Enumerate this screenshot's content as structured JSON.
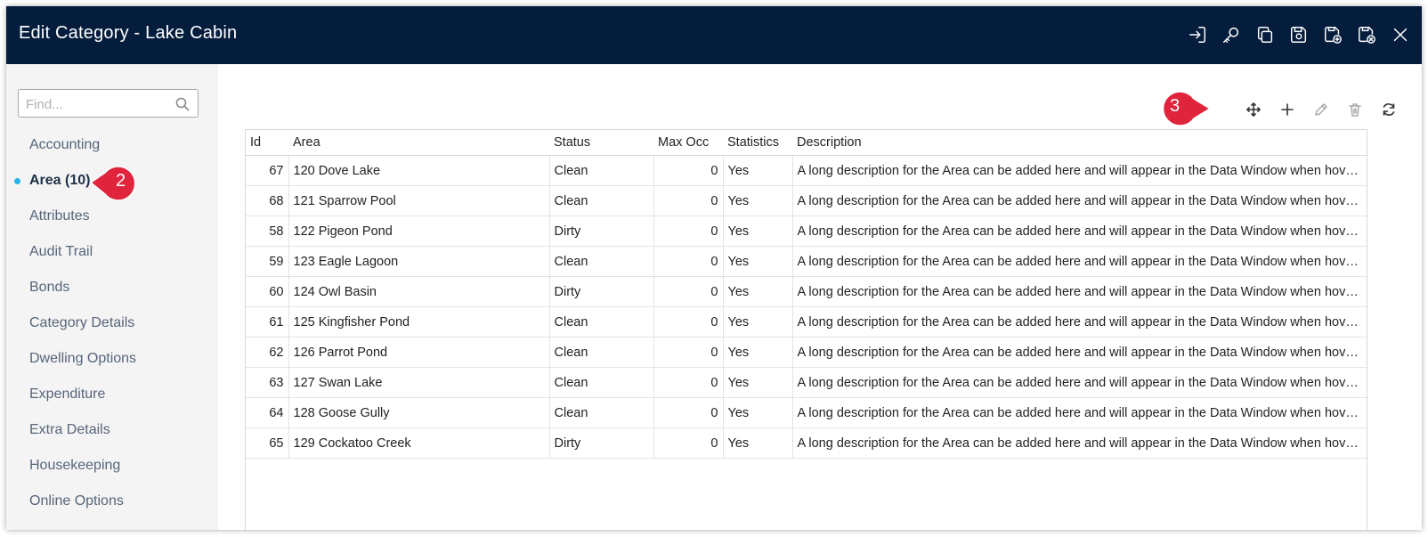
{
  "window": {
    "title": "Edit Category - Lake Cabin"
  },
  "titlebar_icons": [
    "sign-in-icon",
    "key-icon",
    "copy-icon",
    "save-icon",
    "save-and-new-icon",
    "cancel-icon",
    "close-icon"
  ],
  "sidebar": {
    "search_placeholder": "Find...",
    "items": [
      {
        "label": "Accounting"
      },
      {
        "label": "Area (10)",
        "active": true
      },
      {
        "label": "Attributes"
      },
      {
        "label": "Audit Trail"
      },
      {
        "label": "Bonds"
      },
      {
        "label": "Category Details"
      },
      {
        "label": "Dwelling Options"
      },
      {
        "label": "Expenditure"
      },
      {
        "label": "Extra Details"
      },
      {
        "label": "Housekeeping"
      },
      {
        "label": "Online Options"
      }
    ]
  },
  "callouts": {
    "step2": "2",
    "step3": "3"
  },
  "toolbar_icons": [
    "move-icon",
    "add-icon",
    "edit-icon",
    "delete-icon",
    "refresh-icon"
  ],
  "table": {
    "columns": [
      "Id",
      "Area",
      "Status",
      "Max Occ",
      "Statistics",
      "Description"
    ],
    "rows": [
      {
        "id": "67",
        "area": "120 Dove Lake",
        "status": "Clean",
        "max_occ": "0",
        "statistics": "Yes",
        "description": "A long description for the Area can be added here and will appear in the Data Window when hovering"
      },
      {
        "id": "68",
        "area": "121 Sparrow Pool",
        "status": "Clean",
        "max_occ": "0",
        "statistics": "Yes",
        "description": "A long description for the Area can be added here and will appear in the Data Window when hovering"
      },
      {
        "id": "58",
        "area": "122 Pigeon Pond",
        "status": "Dirty",
        "max_occ": "0",
        "statistics": "Yes",
        "description": "A long description for the Area can be added here and will appear in the Data Window when hovering"
      },
      {
        "id": "59",
        "area": "123 Eagle Lagoon",
        "status": "Clean",
        "max_occ": "0",
        "statistics": "Yes",
        "description": "A long description for the Area can be added here and will appear in the Data Window when hovering"
      },
      {
        "id": "60",
        "area": "124 Owl Basin",
        "status": "Dirty",
        "max_occ": "0",
        "statistics": "Yes",
        "description": "A long description for the Area can be added here and will appear in the Data Window when hovering"
      },
      {
        "id": "61",
        "area": "125 Kingfisher Pond",
        "status": "Clean",
        "max_occ": "0",
        "statistics": "Yes",
        "description": "A long description for the Area can be added here and will appear in the Data Window when hovering"
      },
      {
        "id": "62",
        "area": "126 Parrot Pond",
        "status": "Clean",
        "max_occ": "0",
        "statistics": "Yes",
        "description": "A long description for the Area can be added here and will appear in the Data Window when hovering"
      },
      {
        "id": "63",
        "area": "127 Swan Lake",
        "status": "Clean",
        "max_occ": "0",
        "statistics": "Yes",
        "description": "A long description for the Area can be added here and will appear in the Data Window when hovering"
      },
      {
        "id": "64",
        "area": "128 Goose Gully",
        "status": "Clean",
        "max_occ": "0",
        "statistics": "Yes",
        "description": "A long description for the Area can be added here and will appear in the Data Window when hovering"
      },
      {
        "id": "65",
        "area": "129 Cockatoo Creek",
        "status": "Dirty",
        "max_occ": "0",
        "statistics": "Yes",
        "description": "A long description for the Area can be added here and will appear in the Data Window when hovering"
      }
    ]
  },
  "colors": {
    "titlebar": "#051d3d",
    "callout": "#e0243b",
    "active_dot": "#29b3e6",
    "sidebar_bg": "#f4f4f4"
  }
}
